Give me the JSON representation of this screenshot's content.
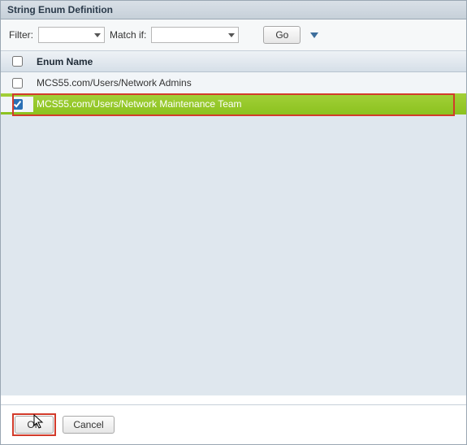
{
  "title": "String Enum Definition",
  "filterbar": {
    "filter_label": "Filter:",
    "filter_value": "",
    "match_label": "Match if:",
    "match_value": "",
    "go_label": "Go"
  },
  "table": {
    "header": {
      "name": "Enum Name"
    },
    "rows": [
      {
        "checked": false,
        "name": "MCS55.com/Users/Network Admins",
        "selected": false
      },
      {
        "checked": true,
        "name": "MCS55.com/Users/Network Maintenance Team",
        "selected": true
      }
    ]
  },
  "footer": {
    "ok_label": "OK",
    "cancel_label": "Cancel"
  }
}
